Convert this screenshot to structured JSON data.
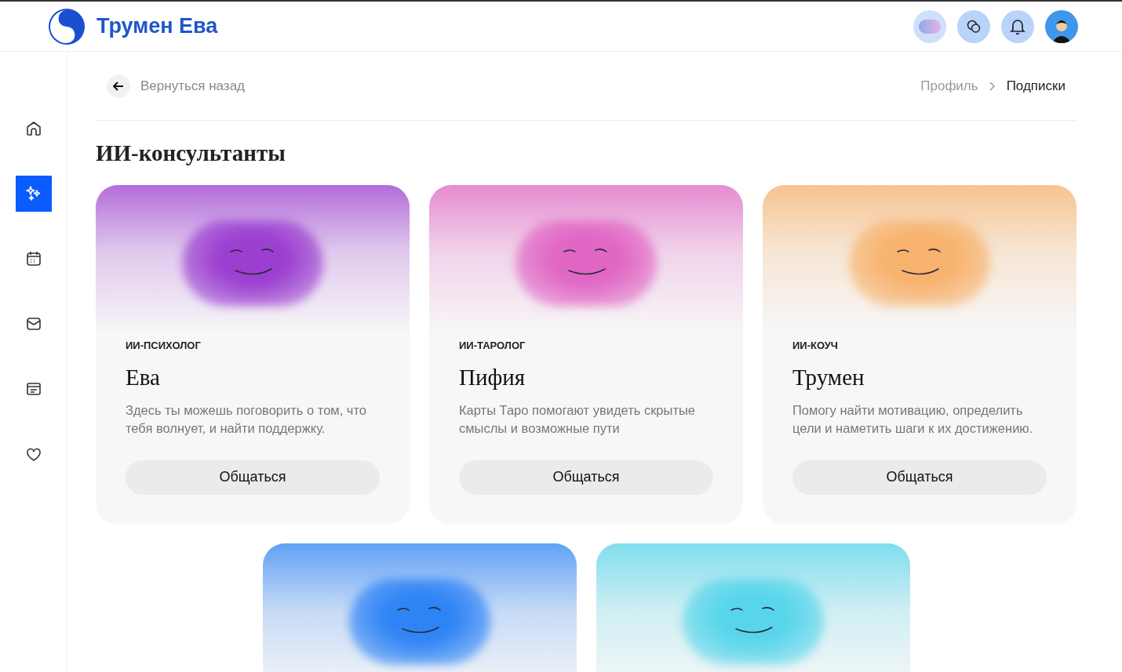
{
  "header": {
    "brand": "Трумен Ева"
  },
  "sidebar": {
    "items": [
      {
        "kind": "home",
        "selected": false
      },
      {
        "kind": "sparkles",
        "selected": true
      },
      {
        "kind": "calendar",
        "selected": false
      },
      {
        "kind": "mail",
        "selected": false
      },
      {
        "kind": "browser",
        "selected": false
      },
      {
        "kind": "heart",
        "selected": false
      }
    ]
  },
  "back_link": "Вернуться назад",
  "breadcrumbs": [
    {
      "label": "Профиль",
      "selected": false
    },
    {
      "label": "Подписки",
      "selected": true
    }
  ],
  "page_title": "ИИ-консультанты",
  "cards": [
    {
      "color": "#9b3fd0",
      "role": "ИИ-ПСИХОЛОГ",
      "name": "Ева",
      "description": "Здесь ты можешь поговорить о том, что тебя волнует, и найти поддержку.",
      "button": "Общаться"
    },
    {
      "color": "#e067c4",
      "role": "ИИ-ТАРОЛОГ",
      "name": "Пифия",
      "description": "Карты Таро помогают увидеть скрытые смыслы и возможные пути",
      "button": "Общаться"
    },
    {
      "color": "#f7b26e",
      "role": "ИИ-КОУЧ",
      "name": "Трумен",
      "description": "Помогу найти мотивацию, определить цели и наметить шаги к их достижению.",
      "button": "Общаться"
    },
    {
      "color": "#2f84f5"
    },
    {
      "color": "#58d5ea"
    }
  ]
}
